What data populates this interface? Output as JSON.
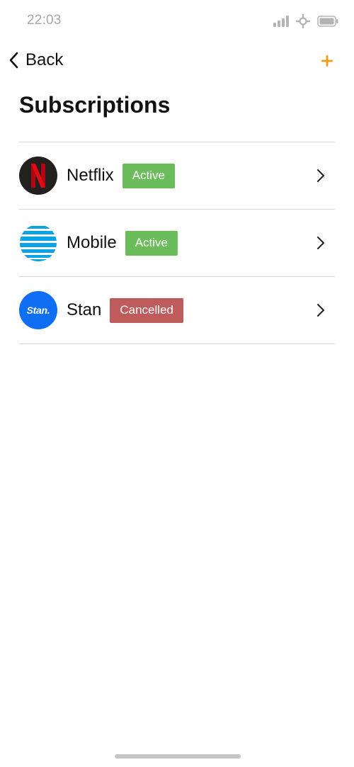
{
  "status_bar": {
    "time": "22:03"
  },
  "nav": {
    "back_label": "Back",
    "add_icon": "plus-icon",
    "accent_color": "#f39c12"
  },
  "page": {
    "title": "Subscriptions"
  },
  "subscriptions": [
    {
      "name": "Netflix",
      "status": "Active",
      "status_color": "#6bbc5a",
      "logo": "netflix-logo"
    },
    {
      "name": "Mobile",
      "status": "Active",
      "status_color": "#6bbc5a",
      "logo": "att-logo"
    },
    {
      "name": "Stan",
      "status": "Cancelled",
      "status_color": "#c05b5b",
      "logo": "stan-logo",
      "logo_text": "Stan."
    }
  ]
}
